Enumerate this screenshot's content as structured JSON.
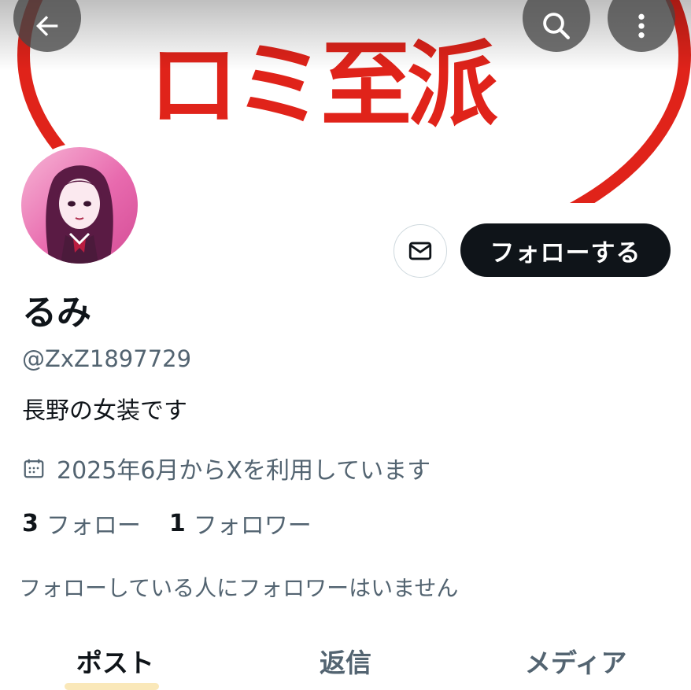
{
  "banner": {
    "text": "ロミ至派"
  },
  "profile": {
    "display_name": "るみ",
    "handle": "@ZxZ1897729",
    "bio": "長野の女装です",
    "joined": "2025年6月からXを利用しています",
    "following_count": "3",
    "following_label": "フォロー",
    "followers_count": "1",
    "followers_label": "フォロワー",
    "followers_you_know": "フォローしている人にフォロワーはいません"
  },
  "actions": {
    "follow_label": "フォローする"
  },
  "tabs": [
    {
      "label": "ポスト",
      "active": true
    },
    {
      "label": "返信",
      "active": false
    },
    {
      "label": "メディア",
      "active": false
    }
  ],
  "icons": {
    "back": "arrow-left-icon",
    "search": "search-icon",
    "more": "more-vertical-icon",
    "message": "envelope-icon",
    "calendar": "calendar-icon"
  },
  "colors": {
    "primary_text": "#0f1419",
    "secondary_text": "#536471",
    "banner_red": "#e0231a"
  }
}
